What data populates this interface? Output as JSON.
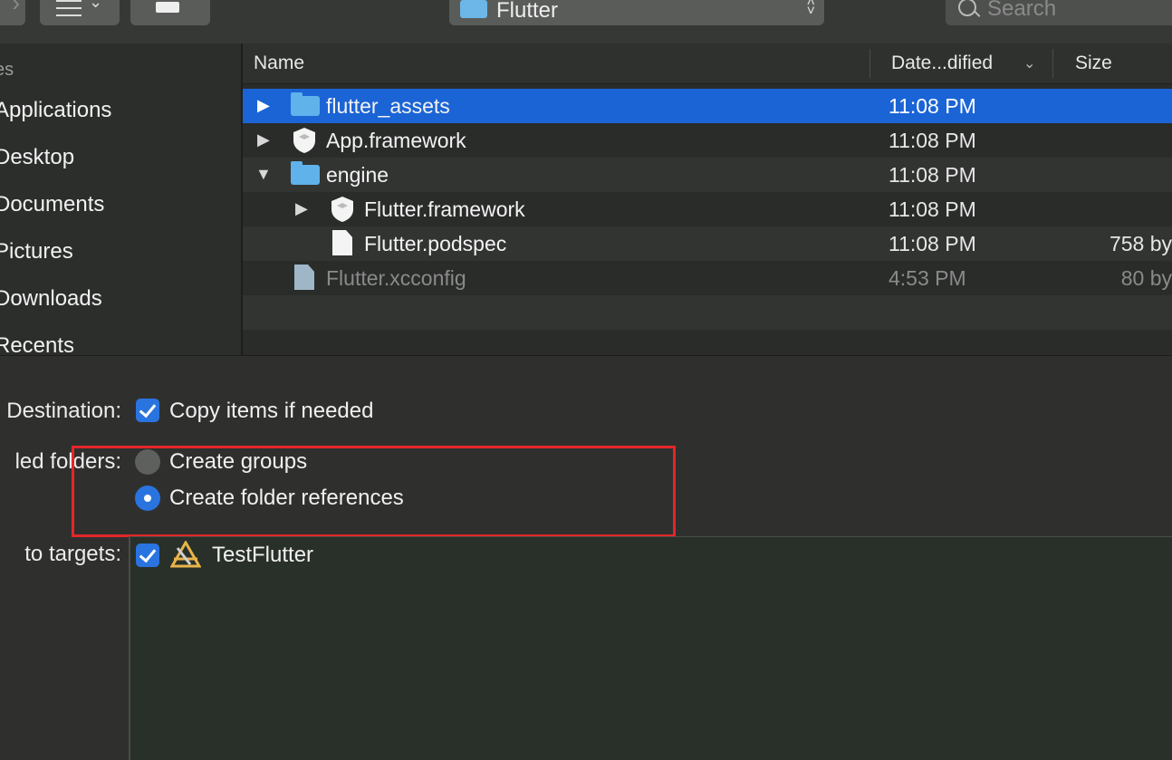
{
  "toolbar": {
    "location": "Flutter",
    "search_placeholder": "Search"
  },
  "sidebar": {
    "heading": "es",
    "items": [
      "Applications",
      "Desktop",
      "Documents",
      "Pictures",
      "Downloads",
      "Recents"
    ]
  },
  "filelist": {
    "columns": {
      "name": "Name",
      "date": "Date...dified",
      "size": "Size"
    },
    "rows": [
      {
        "name": "flutter_assets",
        "date": "11:08 PM",
        "size": ""
      },
      {
        "name": "App.framework",
        "date": "11:08 PM",
        "size": ""
      },
      {
        "name": "engine",
        "date": "11:08 PM",
        "size": ""
      },
      {
        "name": "Flutter.framework",
        "date": "11:08 PM",
        "size": ""
      },
      {
        "name": "Flutter.podspec",
        "date": "11:08 PM",
        "size": "758 by"
      },
      {
        "name": "Flutter.xcconfig",
        "date": "4:53 PM",
        "size": "80 by"
      }
    ]
  },
  "options": {
    "destination_label": "Destination:",
    "copy_items": "Copy items if needed",
    "added_folders_label": "led folders:",
    "create_groups": "Create groups",
    "create_folder_refs": "Create folder references",
    "add_targets_label": "to targets:",
    "target_name": "TestFlutter"
  },
  "colors": {
    "selection": "#1b64d6",
    "checkbox": "#2a74e0",
    "annotation": "#e3262a",
    "folder": "#5fb2ea"
  }
}
